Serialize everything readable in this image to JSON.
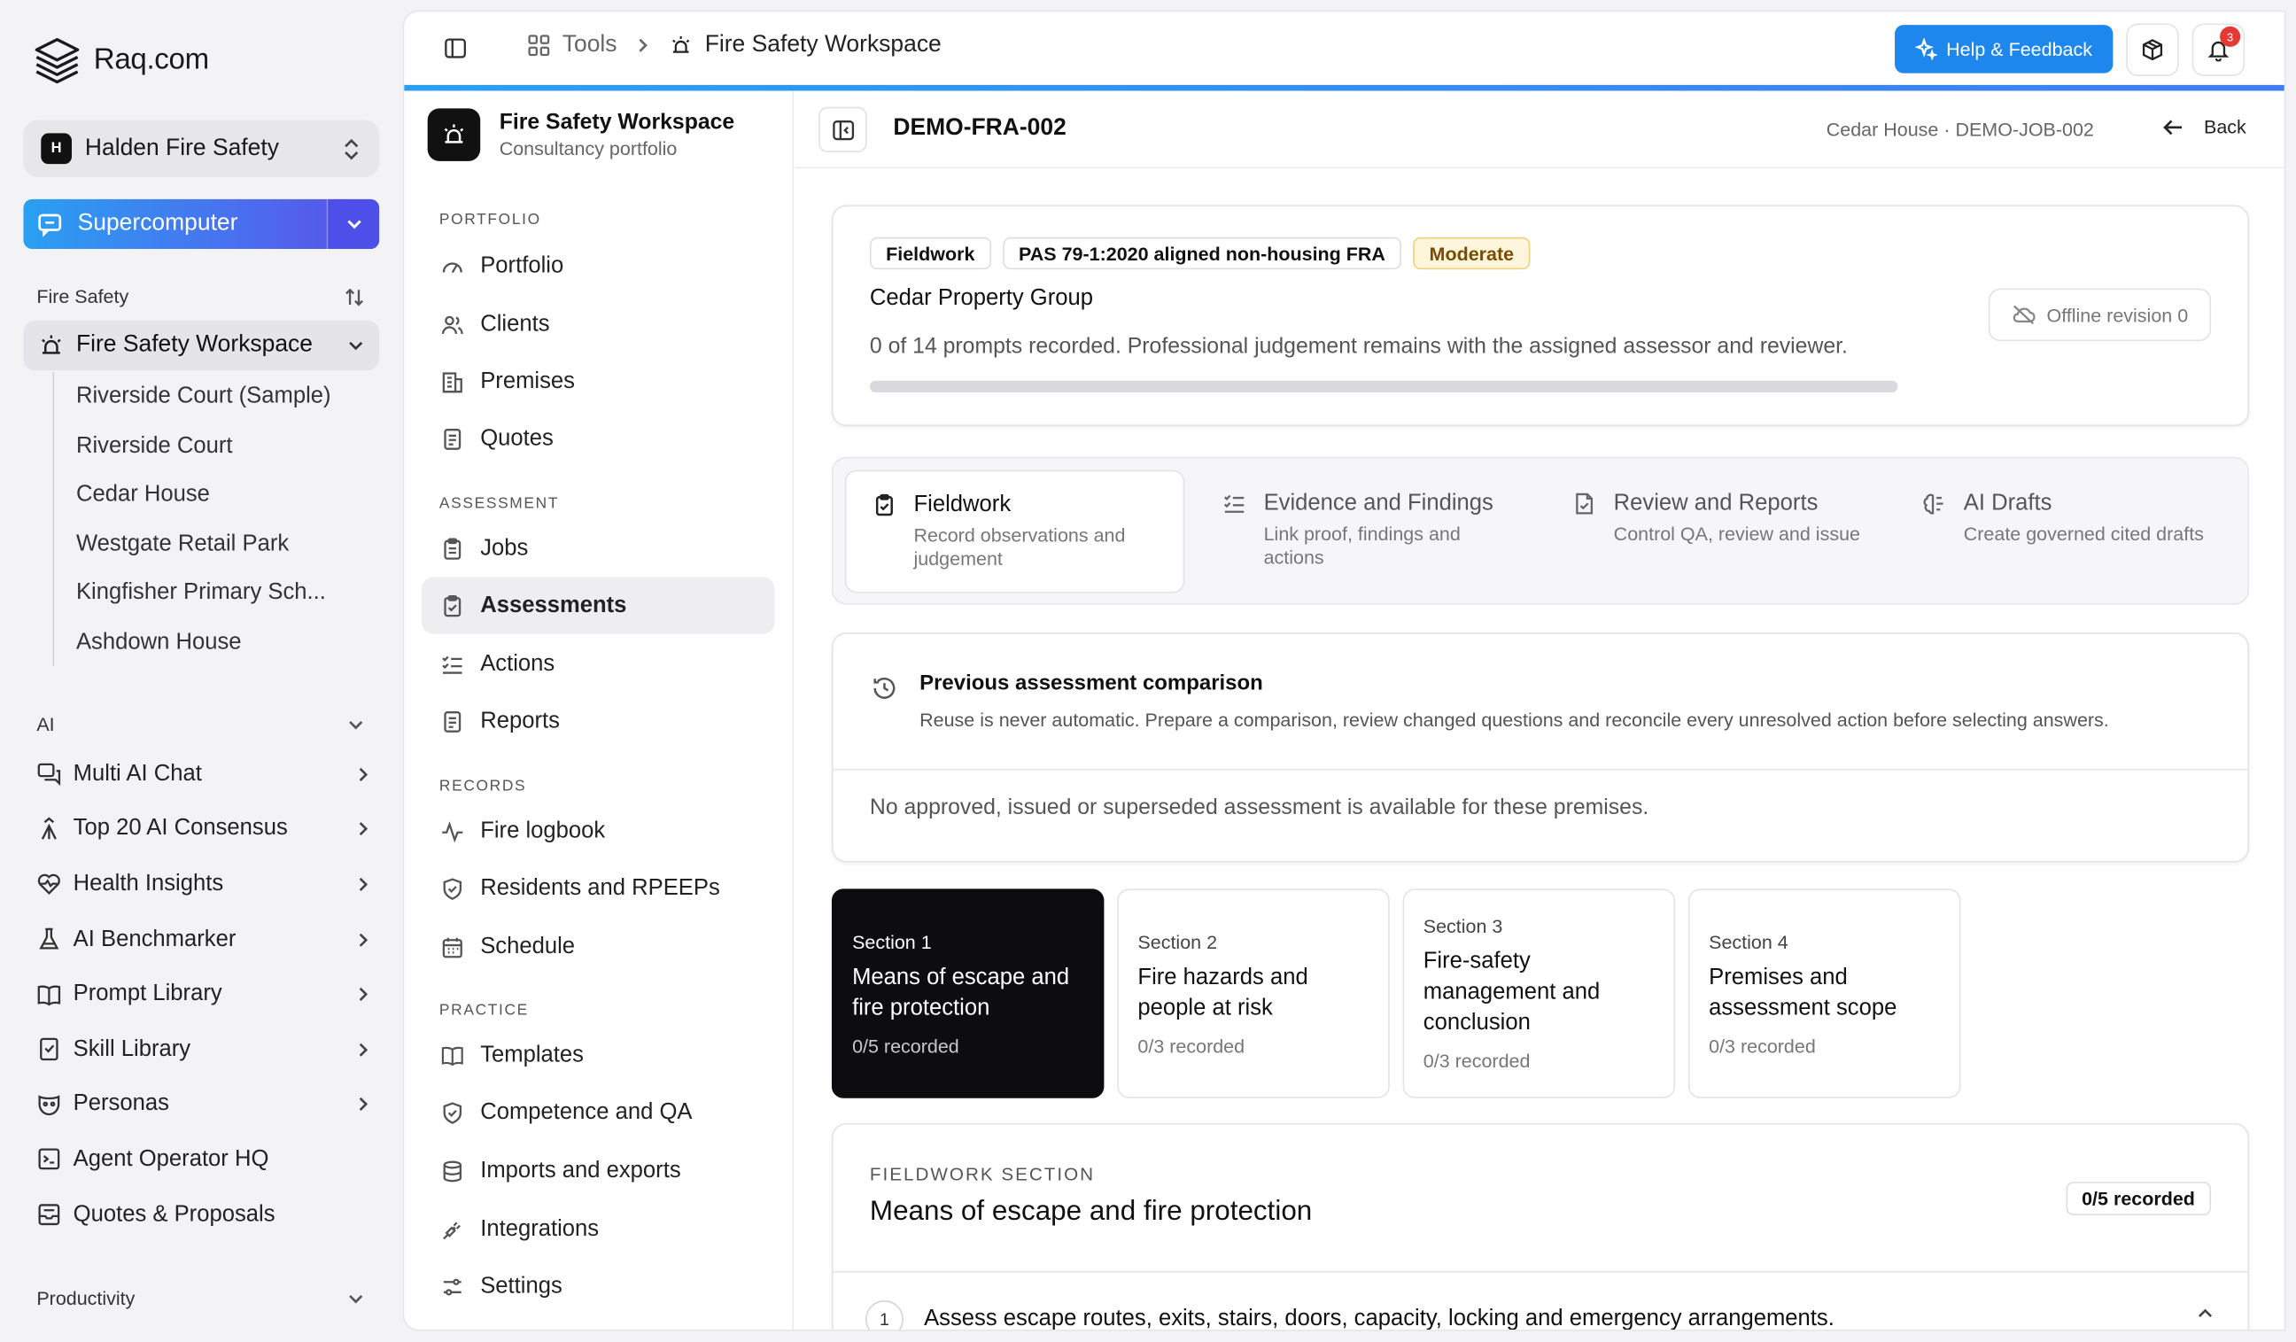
{
  "app": {
    "brand": "Raq.com",
    "org": {
      "badge": "H",
      "name": "Halden Fire Safety"
    },
    "supercomputer_label": "Supercomputer",
    "fire_safety_section": "Fire Safety",
    "workspace_item": "Fire Safety Workspace",
    "workspace_children": [
      "Riverside Court (Sample)",
      "Riverside Court",
      "Cedar House",
      "Westgate Retail Park",
      "Kingfisher Primary Sch...",
      "Ashdown House"
    ],
    "ai_section": "AI",
    "ai_items": [
      "Multi AI Chat",
      "Top 20 AI Consensus",
      "Health Insights",
      "AI Benchmarker",
      "Prompt Library",
      "Skill Library",
      "Personas",
      "Agent Operator HQ",
      "Quotes & Proposals"
    ],
    "productivity_section": "Productivity"
  },
  "topbar": {
    "crumb_tools": "Tools",
    "crumb_current": "Fire Safety Workspace",
    "help_label": "Help & Feedback",
    "notification_count": "3"
  },
  "subnav": {
    "title": "Fire Safety Workspace",
    "subtitle": "Consultancy portfolio",
    "groups": {
      "portfolio": "PORTFOLIO",
      "assessment": "ASSESSMENT",
      "records": "RECORDS",
      "practice": "PRACTICE"
    },
    "portfolio_items": [
      "Portfolio",
      "Clients",
      "Premises",
      "Quotes"
    ],
    "assessment_items": [
      "Jobs",
      "Assessments",
      "Actions",
      "Reports"
    ],
    "records_items": [
      "Fire logbook",
      "Residents and RPEEPs",
      "Schedule"
    ],
    "practice_items": [
      "Templates",
      "Competence and QA",
      "Imports and exports",
      "Integrations",
      "Settings"
    ]
  },
  "content": {
    "doc_id": "DEMO-FRA-002",
    "meta": "Cedar House · DEMO-JOB-002",
    "back_label": "Back",
    "summary": {
      "chips": [
        "Fieldwork",
        "PAS 79-1:2020 aligned non-housing FRA"
      ],
      "risk_chip": "Moderate",
      "client": "Cedar Property Group",
      "progress_text": "0 of 14 prompts recorded. Professional judgement remains with the assigned assessor and reviewer.",
      "progress_fraction": 0,
      "offline_label": "Offline revision 0"
    },
    "tabs": [
      {
        "title": "Fieldwork",
        "desc": "Record observations and judgement"
      },
      {
        "title": "Evidence and Findings",
        "desc": "Link proof, findings and actions"
      },
      {
        "title": "Review and Reports",
        "desc": "Control QA, review and issue"
      },
      {
        "title": "AI Drafts",
        "desc": "Create governed cited drafts"
      }
    ],
    "comparison": {
      "title": "Previous assessment comparison",
      "desc": "Reuse is never automatic. Prepare a comparison, review changed questions and reconcile every unresolved action before selecting answers.",
      "empty": "No approved, issued or superseded assessment is available for these premises."
    },
    "sections": [
      {
        "num": "Section 1",
        "title": "Means of escape and fire protection",
        "recorded": "0/5 recorded"
      },
      {
        "num": "Section 2",
        "title": "Fire hazards and people at risk",
        "recorded": "0/3 recorded"
      },
      {
        "num": "Section 3",
        "title": "Fire-safety management and conclusion",
        "recorded": "0/3 recorded"
      },
      {
        "num": "Section 4",
        "title": "Premises and assessment scope",
        "recorded": "0/3 recorded"
      }
    ],
    "fieldwork": {
      "eyebrow": "FIELDWORK SECTION",
      "title": "Means of escape and fire protection",
      "badge": "0/5 recorded",
      "question_num": "1",
      "question": "Assess escape routes, exits, stairs, doors, capacity, locking and emergency arrangements."
    }
  }
}
